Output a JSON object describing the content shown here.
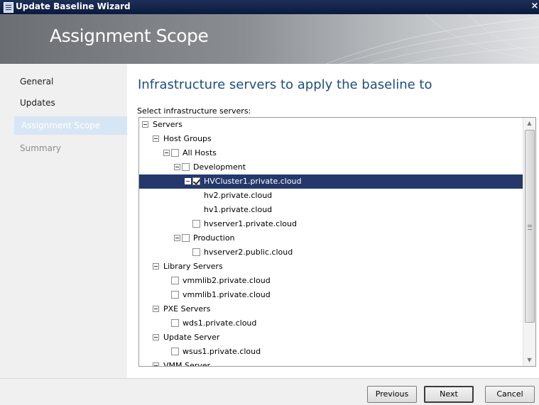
{
  "window": {
    "title": "Update Baseline Wizard",
    "close_glyph": "×"
  },
  "banner": {
    "heading": "Assignment Scope"
  },
  "sidebar": {
    "items": [
      {
        "label": "General"
      },
      {
        "label": "Updates"
      },
      {
        "label": "Assignment Scope"
      },
      {
        "label": "Summary"
      }
    ]
  },
  "main": {
    "page_title": "Infrastructure servers to apply the baseline to",
    "select_label": "Select infrastructure servers:"
  },
  "tree": {
    "rows": [
      {
        "label": "Servers",
        "expander": true,
        "checkbox": false,
        "checked": false,
        "selected": false
      },
      {
        "label": "Host Groups",
        "expander": true,
        "checkbox": false,
        "checked": false,
        "selected": false
      },
      {
        "label": "All Hosts",
        "expander": true,
        "checkbox": true,
        "checked": false,
        "selected": false
      },
      {
        "label": "Development",
        "expander": true,
        "checkbox": true,
        "checked": false,
        "selected": false
      },
      {
        "label": "HVCluster1.private.cloud",
        "expander": true,
        "checkbox": true,
        "checked": true,
        "selected": true
      },
      {
        "label": "hv2.private.cloud",
        "expander": false,
        "checkbox": false,
        "checked": false,
        "selected": false
      },
      {
        "label": "hv1.private.cloud",
        "expander": false,
        "checkbox": false,
        "checked": false,
        "selected": false
      },
      {
        "label": "hvserver1.private.cloud",
        "expander": false,
        "checkbox": true,
        "checked": false,
        "selected": false
      },
      {
        "label": "Production",
        "expander": true,
        "checkbox": true,
        "checked": false,
        "selected": false
      },
      {
        "label": "hvserver2.public.cloud",
        "expander": false,
        "checkbox": true,
        "checked": false,
        "selected": false
      },
      {
        "label": "Library Servers",
        "expander": true,
        "checkbox": false,
        "checked": false,
        "selected": false
      },
      {
        "label": "vmmlib2.private.cloud",
        "expander": false,
        "checkbox": true,
        "checked": false,
        "selected": false
      },
      {
        "label": "vmmlib1.private.cloud",
        "expander": false,
        "checkbox": true,
        "checked": false,
        "selected": false
      },
      {
        "label": "PXE Servers",
        "expander": true,
        "checkbox": false,
        "checked": false,
        "selected": false
      },
      {
        "label": "wds1.private.cloud",
        "expander": false,
        "checkbox": true,
        "checked": false,
        "selected": false
      },
      {
        "label": "Update Server",
        "expander": true,
        "checkbox": false,
        "checked": false,
        "selected": false
      },
      {
        "label": "wsus1.private.cloud",
        "expander": false,
        "checkbox": true,
        "checked": false,
        "selected": false
      },
      {
        "label": "VMM Server",
        "expander": true,
        "checkbox": false,
        "checked": false,
        "selected": false
      }
    ]
  },
  "footer": {
    "previous_label": "Previous",
    "next_label": "Next",
    "cancel_label": "Cancel"
  },
  "colors": {
    "selection": "#25386b",
    "title_blue": "#1f4e79",
    "titlebar": "#0b1a3e"
  }
}
